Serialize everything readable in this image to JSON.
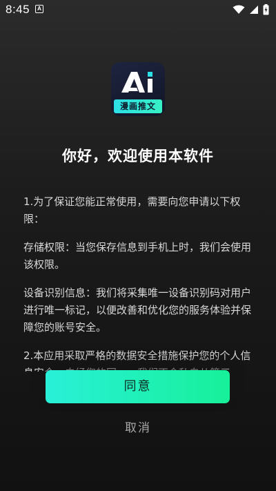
{
  "status_bar": {
    "time": "8:45",
    "notification_letter": "A",
    "icons": [
      "wifi-icon",
      "signal-icon",
      "battery-charging-icon"
    ]
  },
  "app": {
    "logo_text": "Ai",
    "logo_banner": "漫画推文"
  },
  "dialog": {
    "title": "你好，欢迎使用本软件",
    "paragraphs": [
      "1.为了保证您能正常使用，需要向您申请以下权限：",
      "存储权限：当您保存信息到手机上时，我们会使用该权限。",
      "设备识别信息：我们将采集唯一设备识别码对用户进行唯一标记，以便改善和优化您的服务体验并保障您的账号安全。",
      "2.本应用采取严格的数据安全措施保护您的个人信息安全，未经您的同一，我们不会私自从第三"
    ],
    "agree_label": "同意",
    "cancel_label": "取消"
  },
  "colors": {
    "accent_start": "#29f0d8",
    "accent_end": "#17f09a",
    "background": "#1c1c1c"
  }
}
